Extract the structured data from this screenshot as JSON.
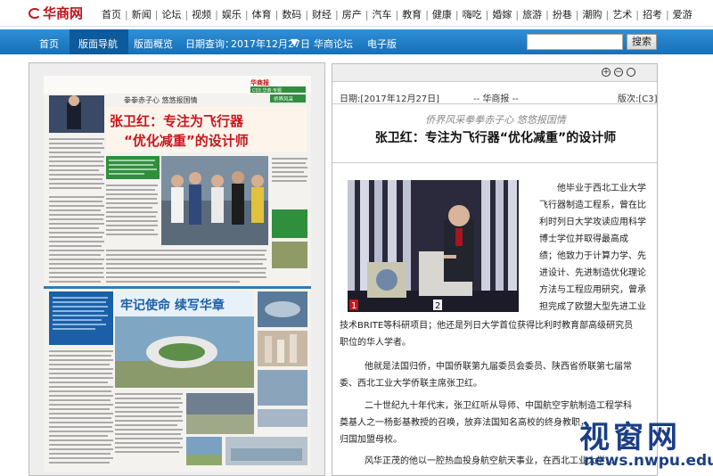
{
  "site": {
    "logo_text": "华商网"
  },
  "channels": [
    "首页",
    "新闻",
    "论坛",
    "视频",
    "娱乐",
    "体育",
    "数码",
    "财经",
    "房产",
    "汽车",
    "教育",
    "健康",
    "嗨吃",
    "婚嫁",
    "旅游",
    "扮巷",
    "潮购",
    "艺术",
    "招考",
    "爱游"
  ],
  "nav": {
    "items": [
      "首页",
      "版面导航",
      "版面概览",
      "日期查询：",
      "2017年12月27日",
      "华商论坛",
      "电子版"
    ],
    "active": "版面导航",
    "search_button": "搜索",
    "search_placeholder": ""
  },
  "newspaper": {
    "page_label": "C03 华商·专题",
    "section_banner": "拳拳赤子心 悠悠报国情",
    "headline_line1": "张卫红：专注为飞行器",
    "headline_line2": "“优化减重”的设计师",
    "lower_headline": "牢记使命 续写华章",
    "column_badge": "侨界风采"
  },
  "article": {
    "date": "日期:[2017年12月27日]",
    "source": "-- 华商报 --",
    "edition": "版次:[C3]",
    "kicker": "侨界风采拳拳赤子心 悠悠报国情",
    "title": "张卫红：专注为飞行器“优化减重”的设计师",
    "photo_badges": [
      "1",
      "2"
    ],
    "para1_lines": [
      "他毕业于西北工业大学",
      "飞行器制造工程系，曾在比",
      "利时列日大学攻读应用科学",
      "博士学位并取得最高成",
      "绩；他致力于计算力学、先",
      "进设计、先进制造优化理论",
      "方法与工程应用研究，曾承",
      "担完成了欧盟大型先进工业"
    ],
    "para1_tail": [
      "技术BRITE等科研项目；他还是列日大学首位获得比利时教育部高级研究员",
      "职位的华人学者。"
    ],
    "para2": [
      "他就是法国归侨，中国侨联第九届委员会委员、陕西省侨联第七届常",
      "委、西北工业大学侨联主席张卫红。"
    ],
    "para3": [
      "二十世纪九十年代末，张卫红听从导师、中国航空宇航制造工程学科",
      "奠基人之一杨彭基教授的召唤，放弃法国知名高校的终身教职，",
      "归国加盟母校。"
    ],
    "para4": "风华正茂的他以一腔热血投身航空航天事业，在西北工业大学..."
  },
  "watermark": {
    "text": "视窗网",
    "url": "news.nwpu.edu.cn"
  }
}
